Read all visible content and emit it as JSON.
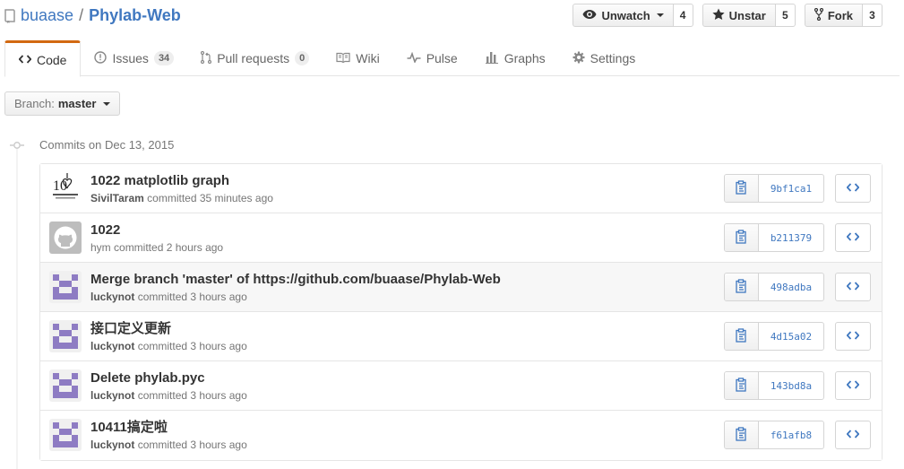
{
  "repo": {
    "owner": "buaase",
    "separator": "/",
    "name": "Phylab-Web"
  },
  "actions": {
    "watch": {
      "label": "Unwatch",
      "count": "4"
    },
    "star": {
      "label": "Unstar",
      "count": "5"
    },
    "fork": {
      "label": "Fork",
      "count": "3"
    }
  },
  "tabs": [
    {
      "label": "Code",
      "icon": "code-icon"
    },
    {
      "label": "Issues",
      "icon": "issue-icon",
      "counter": "34"
    },
    {
      "label": "Pull requests",
      "icon": "pull-request-icon",
      "counter": "0"
    },
    {
      "label": "Wiki",
      "icon": "book-icon"
    },
    {
      "label": "Pulse",
      "icon": "pulse-icon"
    },
    {
      "label": "Graphs",
      "icon": "graph-icon"
    },
    {
      "label": "Settings",
      "icon": "gear-icon"
    }
  ],
  "branch": {
    "prefix": "Branch:",
    "name": "master"
  },
  "commit_group": {
    "title": "Commits on Dec 13, 2015"
  },
  "commits": [
    {
      "message": "1022 matplotlib graph",
      "author": "SivilTaram",
      "action": "committed",
      "time": "35 minutes ago",
      "sha": "9bf1ca1",
      "avatar": "logo"
    },
    {
      "message": "1022",
      "author": "hym",
      "action": "committed",
      "time": "2 hours ago",
      "sha": "b211379",
      "avatar": "github-default"
    },
    {
      "message": "Merge branch 'master' of https://github.com/buaase/Phylab-Web",
      "author": "luckynot",
      "action": "committed",
      "time": "3 hours ago",
      "sha": "498adba",
      "avatar": "identicon"
    },
    {
      "message": "接口定义更新",
      "author": "luckynot",
      "action": "committed",
      "time": "3 hours ago",
      "sha": "4d15a02",
      "avatar": "identicon"
    },
    {
      "message": "Delete phylab.pyc",
      "author": "luckynot",
      "action": "committed",
      "time": "3 hours ago",
      "sha": "143bd8a",
      "avatar": "identicon"
    },
    {
      "message": "10411搞定啦",
      "author": "luckynot",
      "action": "committed",
      "time": "3 hours ago",
      "sha": "f61afb8",
      "avatar": "identicon"
    }
  ],
  "colors": {
    "link": "#4078c0",
    "tab_accent": "#d26911",
    "identicon": "#8e7cc3"
  }
}
